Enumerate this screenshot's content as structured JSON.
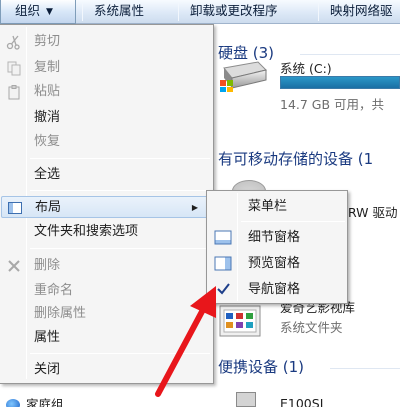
{
  "toolbar": {
    "organize": "组织",
    "system_properties": "系统属性",
    "uninstall": "卸载或更改程序",
    "map_drive": "映射网络驱"
  },
  "content": {
    "hard_disks_header": "硬盘 (3)",
    "drive_name": "系统 (C:)",
    "drive_free": "14.7 GB 可用，共",
    "drive_usage": 0.85,
    "removable_header": "有可移动存储的设备 (1",
    "cd_label": "RW 驱动",
    "library_name": "爱奇艺影视库",
    "library_type": "系统文件夹",
    "portable_header": "便携设备 (1)",
    "device_name": "E100SL"
  },
  "menu": {
    "items": [
      {
        "label": "剪切",
        "enabled": false,
        "icon": "scissors-icon"
      },
      {
        "label": "复制",
        "enabled": false,
        "icon": "copy-icon"
      },
      {
        "label": "粘贴",
        "enabled": false,
        "icon": "paste-icon"
      },
      {
        "label": "撤消",
        "enabled": true
      },
      {
        "label": "恢复",
        "enabled": false
      },
      {
        "label": "全选",
        "enabled": true
      },
      {
        "label": "布局",
        "enabled": true,
        "icon": "layout-icon",
        "submenu": true
      },
      {
        "label": "文件夹和搜索选项",
        "enabled": true
      },
      {
        "label": "删除",
        "enabled": false,
        "icon": "delete-icon"
      },
      {
        "label": "重命名",
        "enabled": false
      },
      {
        "label": "删除属性",
        "enabled": false
      },
      {
        "label": "属性",
        "enabled": true
      },
      {
        "label": "关闭",
        "enabled": true
      }
    ]
  },
  "submenu": {
    "items": [
      {
        "label": "菜单栏",
        "checked": false
      },
      {
        "label": "细节窗格",
        "checked": false,
        "icon": "details-pane-icon"
      },
      {
        "label": "预览窗格",
        "checked": false,
        "icon": "preview-pane-icon"
      },
      {
        "label": "导航窗格",
        "checked": true,
        "icon": "check-icon"
      }
    ]
  },
  "nav": {
    "homegroup": "家庭组"
  },
  "colors": {
    "accent_text": "#1a3a80",
    "arrow": "#e8161b",
    "drive_bar": "#2b97c8"
  }
}
